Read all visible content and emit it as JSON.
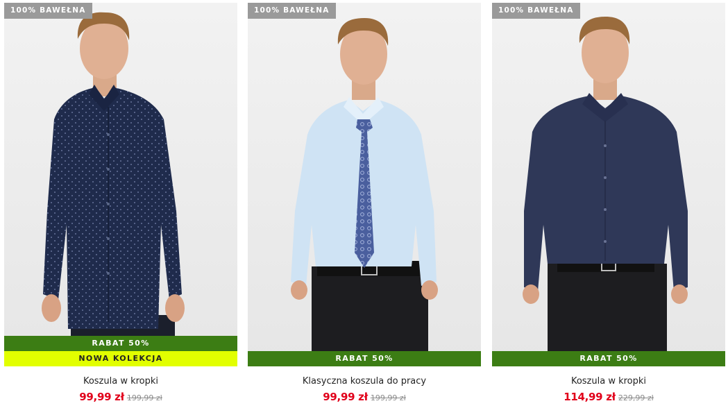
{
  "products": [
    {
      "tag": "100% BAWEŁNA",
      "discount": "RABAT 50%",
      "badge": "NOWA KOLEKCJA",
      "name": "Koszula w kropki",
      "price": "99,99 zł",
      "old_price": "199,99 zł",
      "shirt_color": "#1f2b4c",
      "pattern": "dots"
    },
    {
      "tag": "100% BAWEŁNA",
      "discount": "RABAT 50%",
      "name": "Klasyczna koszula do pracy",
      "price": "99,99 zł",
      "old_price": "199,99 zł",
      "shirt_color": "#cfe3f4",
      "tie_color": "#4a5f9e",
      "pattern": "plain"
    },
    {
      "tag": "100% BAWEŁNA",
      "discount": "RABAT 50%",
      "name": "Koszula w kropki",
      "price": "114,99 zł",
      "old_price": "229,99 zł",
      "shirt_color": "#2f3858",
      "pattern": "plain"
    }
  ],
  "colors": {
    "discount_ribbon": "#3c7d14",
    "new_collection_ribbon": "#e2ff00",
    "tag_bg": "#9a9a9a",
    "price": "#e1001a"
  }
}
